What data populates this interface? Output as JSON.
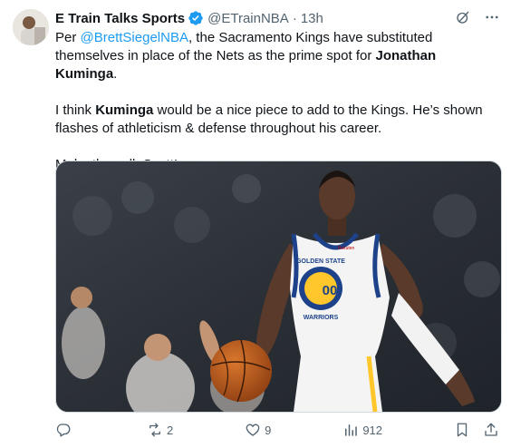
{
  "author": {
    "display_name": "E Train Talks Sports",
    "handle": "@ETrainNBA",
    "separator": "·",
    "time": "13h",
    "verified_color": "#1d9bf0"
  },
  "tweet": {
    "line1_prefix": "Per ",
    "line1_mention": "@BrettSiegelNBA",
    "line1_mid": ", the Sacramento Kings have substituted themselves in place of the Nets as the prime spot for ",
    "line1_bold": "Jonathan Kuminga",
    "line1_end": ".",
    "line2_prefix": "I think ",
    "line2_bold": "Kuminga",
    "line2_rest": " would be a nice piece to add to the Kings. He’s shown flashes of athleticism & defense throughout his career.",
    "line3": "Make the call, Scott!"
  },
  "media": {
    "jersey_number": "00",
    "jersey_text_top": "GOLDEN STATE",
    "jersey_text_bottom": "WARRIORS",
    "jersey_sponsor": "Rakuten"
  },
  "actions": {
    "reply_count": "",
    "retweet_count": "2",
    "like_count": "9",
    "views_count": "912"
  },
  "colors": {
    "accent": "#1d9bf0",
    "muted": "#536471",
    "text": "#0f1419"
  }
}
